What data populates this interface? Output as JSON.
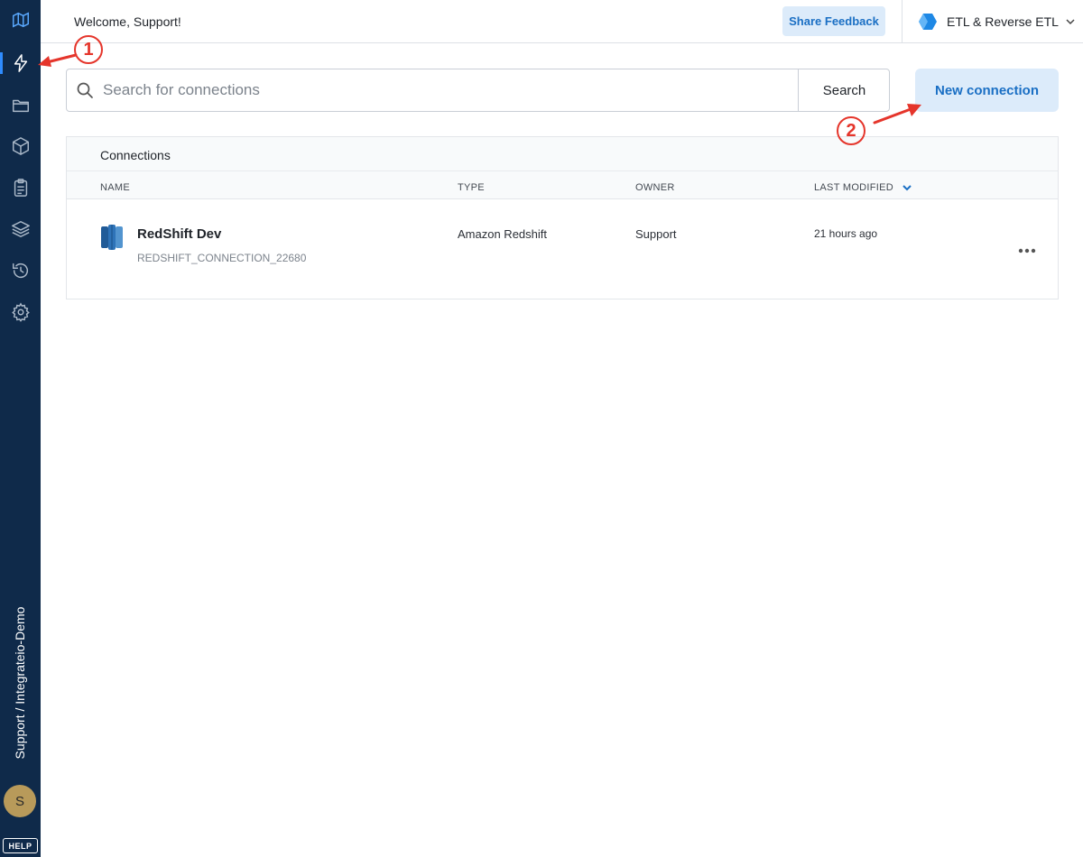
{
  "sidebar": {
    "items": [
      {
        "name": "logo-icon"
      },
      {
        "name": "lightning-icon"
      },
      {
        "name": "folder-icon"
      },
      {
        "name": "package-icon"
      },
      {
        "name": "clipboard-icon"
      },
      {
        "name": "layers-icon"
      },
      {
        "name": "history-icon"
      },
      {
        "name": "gear-icon"
      }
    ],
    "org_label": "Support / Integrateio-Demo",
    "avatar_initial": "S",
    "help_label": "HELP"
  },
  "header": {
    "welcome": "Welcome, Support!",
    "feedback_label": "Share Feedback",
    "product_label": "ETL & Reverse ETL"
  },
  "search": {
    "placeholder": "Search for connections",
    "button_label": "Search"
  },
  "new_connection_label": "New connection",
  "table": {
    "title": "Connections",
    "columns": [
      "NAME",
      "TYPE",
      "OWNER",
      "LAST MODIFIED"
    ],
    "rows": [
      {
        "name": "RedShift Dev",
        "id": "REDSHIFT_CONNECTION_22680",
        "type": "Amazon Redshift",
        "owner": "Support",
        "modified": "21 hours ago"
      }
    ]
  },
  "annotations": {
    "step1": "1",
    "step2": "2",
    "color": "#e5352b"
  },
  "colors": {
    "sidebar_bg": "#0f2a4a",
    "accent": "#1a6fc4",
    "button_bg": "#dcebfa"
  }
}
